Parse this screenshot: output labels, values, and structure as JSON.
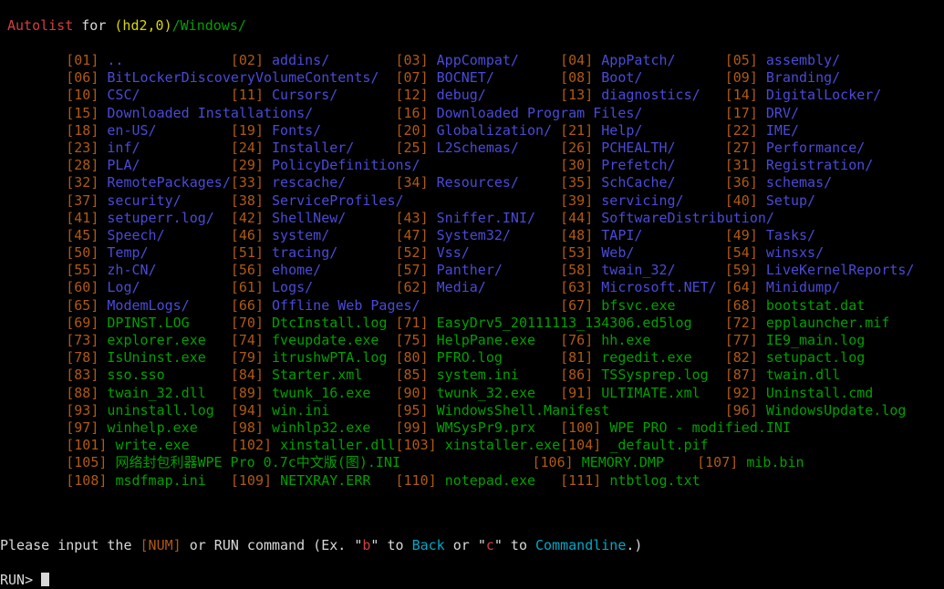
{
  "header": {
    "app_label": "Autolist",
    "for_label": "for",
    "device": "(hd2,0)",
    "path": "/Windows/"
  },
  "colors": {
    "app_label": "#d04040",
    "device": "#d8d800",
    "path": "#00a000",
    "directory": "#4a4ad8",
    "file": "#00a000",
    "index_number": "#b05a10",
    "plain_text": "#d8d8d8",
    "highlight_cyan": "#00a8c8",
    "highlight_red": "#d04040",
    "background": "#000000"
  },
  "listing": {
    "column_char_positions": [
      8,
      28,
      48,
      68,
      88
    ],
    "line_width_chars": 118,
    "entries": [
      {
        "index": "01",
        "name": "..",
        "type": "dir"
      },
      {
        "index": "02",
        "name": "addins/",
        "type": "dir"
      },
      {
        "index": "03",
        "name": "AppCompat/",
        "type": "dir"
      },
      {
        "index": "04",
        "name": "AppPatch/",
        "type": "dir"
      },
      {
        "index": "05",
        "name": "assembly/",
        "type": "dir"
      },
      {
        "index": "06",
        "name": "BitLockerDiscoveryVolumeContents/",
        "type": "dir"
      },
      {
        "index": "07",
        "name": "BOCNET/",
        "type": "dir"
      },
      {
        "index": "08",
        "name": "Boot/",
        "type": "dir"
      },
      {
        "index": "09",
        "name": "Branding/",
        "type": "dir"
      },
      {
        "index": "10",
        "name": "CSC/",
        "type": "dir"
      },
      {
        "index": "11",
        "name": "Cursors/",
        "type": "dir"
      },
      {
        "index": "12",
        "name": "debug/",
        "type": "dir"
      },
      {
        "index": "13",
        "name": "diagnostics/",
        "type": "dir"
      },
      {
        "index": "14",
        "name": "DigitalLocker/",
        "type": "dir"
      },
      {
        "index": "15",
        "name": "Downloaded Installations/",
        "type": "dir"
      },
      {
        "index": "16",
        "name": "Downloaded Program Files/",
        "type": "dir"
      },
      {
        "index": "17",
        "name": "DRV/",
        "type": "dir"
      },
      {
        "index": "18",
        "name": "en-US/",
        "type": "dir"
      },
      {
        "index": "19",
        "name": "Fonts/",
        "type": "dir"
      },
      {
        "index": "20",
        "name": "Globalization/",
        "type": "dir"
      },
      {
        "index": "21",
        "name": "Help/",
        "type": "dir"
      },
      {
        "index": "22",
        "name": "IME/",
        "type": "dir"
      },
      {
        "index": "23",
        "name": "inf/",
        "type": "dir"
      },
      {
        "index": "24",
        "name": "Installer/",
        "type": "dir"
      },
      {
        "index": "25",
        "name": "L2Schemas/",
        "type": "dir"
      },
      {
        "index": "26",
        "name": "PCHEALTH/",
        "type": "dir"
      },
      {
        "index": "27",
        "name": "Performance/",
        "type": "dir"
      },
      {
        "index": "28",
        "name": "PLA/",
        "type": "dir"
      },
      {
        "index": "29",
        "name": "PolicyDefinitions/",
        "type": "dir"
      },
      {
        "index": "30",
        "name": "Prefetch/",
        "type": "dir"
      },
      {
        "index": "31",
        "name": "Registration/",
        "type": "dir"
      },
      {
        "index": "32",
        "name": "RemotePackages/",
        "type": "dir"
      },
      {
        "index": "33",
        "name": "rescache/",
        "type": "dir"
      },
      {
        "index": "34",
        "name": "Resources/",
        "type": "dir"
      },
      {
        "index": "35",
        "name": "SchCache/",
        "type": "dir"
      },
      {
        "index": "36",
        "name": "schemas/",
        "type": "dir"
      },
      {
        "index": "37",
        "name": "security/",
        "type": "dir"
      },
      {
        "index": "38",
        "name": "ServiceProfiles/",
        "type": "dir"
      },
      {
        "index": "39",
        "name": "servicing/",
        "type": "dir"
      },
      {
        "index": "40",
        "name": "Setup/",
        "type": "dir"
      },
      {
        "index": "41",
        "name": "setuperr.log/",
        "type": "dir"
      },
      {
        "index": "42",
        "name": "ShellNew/",
        "type": "dir"
      },
      {
        "index": "43",
        "name": "Sniffer.INI/",
        "type": "dir"
      },
      {
        "index": "44",
        "name": "SoftwareDistribution/",
        "type": "dir"
      },
      {
        "index": "45",
        "name": "Speech/",
        "type": "dir"
      },
      {
        "index": "46",
        "name": "system/",
        "type": "dir"
      },
      {
        "index": "47",
        "name": "System32/",
        "type": "dir"
      },
      {
        "index": "48",
        "name": "TAPI/",
        "type": "dir"
      },
      {
        "index": "49",
        "name": "Tasks/",
        "type": "dir"
      },
      {
        "index": "50",
        "name": "Temp/",
        "type": "dir"
      },
      {
        "index": "51",
        "name": "tracing/",
        "type": "dir"
      },
      {
        "index": "52",
        "name": "Vss/",
        "type": "dir"
      },
      {
        "index": "53",
        "name": "Web/",
        "type": "dir"
      },
      {
        "index": "54",
        "name": "winsxs/",
        "type": "dir"
      },
      {
        "index": "55",
        "name": "zh-CN/",
        "type": "dir"
      },
      {
        "index": "56",
        "name": "ehome/",
        "type": "dir"
      },
      {
        "index": "57",
        "name": "Panther/",
        "type": "dir"
      },
      {
        "index": "58",
        "name": "twain_32/",
        "type": "dir"
      },
      {
        "index": "59",
        "name": "LiveKernelReports/",
        "type": "dir"
      },
      {
        "index": "60",
        "name": "Log/",
        "type": "dir"
      },
      {
        "index": "61",
        "name": "Logs/",
        "type": "dir"
      },
      {
        "index": "62",
        "name": "Media/",
        "type": "dir"
      },
      {
        "index": "63",
        "name": "Microsoft.NET/",
        "type": "dir"
      },
      {
        "index": "64",
        "name": "Minidump/",
        "type": "dir"
      },
      {
        "index": "65",
        "name": "ModemLogs/",
        "type": "dir"
      },
      {
        "index": "66",
        "name": "Offline Web Pages/",
        "type": "dir"
      },
      {
        "index": "67",
        "name": "bfsvc.exe",
        "type": "file"
      },
      {
        "index": "68",
        "name": "bootstat.dat",
        "type": "file"
      },
      {
        "index": "69",
        "name": "DPINST.LOG",
        "type": "file"
      },
      {
        "index": "70",
        "name": "DtcInstall.log",
        "type": "file"
      },
      {
        "index": "71",
        "name": "EasyDrv5_20111113_134306.ed5log",
        "type": "file"
      },
      {
        "index": "72",
        "name": "epplauncher.mif",
        "type": "file"
      },
      {
        "index": "73",
        "name": "explorer.exe",
        "type": "file"
      },
      {
        "index": "74",
        "name": "fveupdate.exe",
        "type": "file"
      },
      {
        "index": "75",
        "name": "HelpPane.exe",
        "type": "file"
      },
      {
        "index": "76",
        "name": "hh.exe",
        "type": "file"
      },
      {
        "index": "77",
        "name": "IE9_main.log",
        "type": "file"
      },
      {
        "index": "78",
        "name": "IsUninst.exe",
        "type": "file"
      },
      {
        "index": "79",
        "name": "itrushwPTA.log",
        "type": "file"
      },
      {
        "index": "80",
        "name": "PFRO.log",
        "type": "file"
      },
      {
        "index": "81",
        "name": "regedit.exe",
        "type": "file"
      },
      {
        "index": "82",
        "name": "setupact.log",
        "type": "file"
      },
      {
        "index": "83",
        "name": "sso.sso",
        "type": "file"
      },
      {
        "index": "84",
        "name": "Starter.xml",
        "type": "file"
      },
      {
        "index": "85",
        "name": "system.ini",
        "type": "file"
      },
      {
        "index": "86",
        "name": "TSSysprep.log",
        "type": "file"
      },
      {
        "index": "87",
        "name": "twain.dll",
        "type": "file"
      },
      {
        "index": "88",
        "name": "twain_32.dll",
        "type": "file"
      },
      {
        "index": "89",
        "name": "twunk_16.exe",
        "type": "file"
      },
      {
        "index": "90",
        "name": "twunk_32.exe",
        "type": "file"
      },
      {
        "index": "91",
        "name": "ULTIMATE.xml",
        "type": "file"
      },
      {
        "index": "92",
        "name": "Uninstall.cmd",
        "type": "file"
      },
      {
        "index": "93",
        "name": "uninstall.log",
        "type": "file"
      },
      {
        "index": "94",
        "name": "win.ini",
        "type": "file"
      },
      {
        "index": "95",
        "name": "WindowsShell.Manifest",
        "type": "file"
      },
      {
        "index": "96",
        "name": "WindowsUpdate.log",
        "type": "file"
      },
      {
        "index": "97",
        "name": "winhelp.exe",
        "type": "file"
      },
      {
        "index": "98",
        "name": "winhlp32.exe",
        "type": "file"
      },
      {
        "index": "99",
        "name": "WMSysPr9.prx",
        "type": "file"
      },
      {
        "index": "100",
        "name": "WPE PRO - modified.INI",
        "type": "file"
      },
      {
        "index": "101",
        "name": "write.exe",
        "type": "file"
      },
      {
        "index": "102",
        "name": "xinstaller.dll",
        "type": "file"
      },
      {
        "index": "103",
        "name": "xinstaller.exe",
        "type": "file"
      },
      {
        "index": "104",
        "name": "_default.pif",
        "type": "file"
      },
      {
        "index": "105",
        "name": "网络封包利器WPE Pro 0.7c中文版(图).INI",
        "type": "file"
      },
      {
        "index": "106",
        "name": "MEMORY.DMP",
        "type": "file"
      },
      {
        "index": "107",
        "name": "mib.bin",
        "type": "file"
      },
      {
        "index": "108",
        "name": "msdfmap.ini",
        "type": "file"
      },
      {
        "index": "109",
        "name": "NETXRAY.ERR",
        "type": "file"
      },
      {
        "index": "110",
        "name": "notepad.exe",
        "type": "file"
      },
      {
        "index": "111",
        "name": "ntbtlog.txt",
        "type": "file"
      }
    ]
  },
  "prompt": {
    "text_1": "Please input the ",
    "num_token": "[NUM]",
    "text_2": " or RUN command (Ex. ",
    "quote_open_1": "\"",
    "key_back": "b",
    "quote_close_1": "\"",
    "text_3": " to ",
    "action_back": "Back",
    "text_4": " or ",
    "quote_open_2": "\"",
    "key_cmdline": "c",
    "quote_close_2": "\"",
    "text_5": " to ",
    "action_cmdline": "Commandline",
    "text_6": ".)"
  },
  "run_line": {
    "label": "RUN>",
    "value": "",
    "cursor": "_"
  }
}
